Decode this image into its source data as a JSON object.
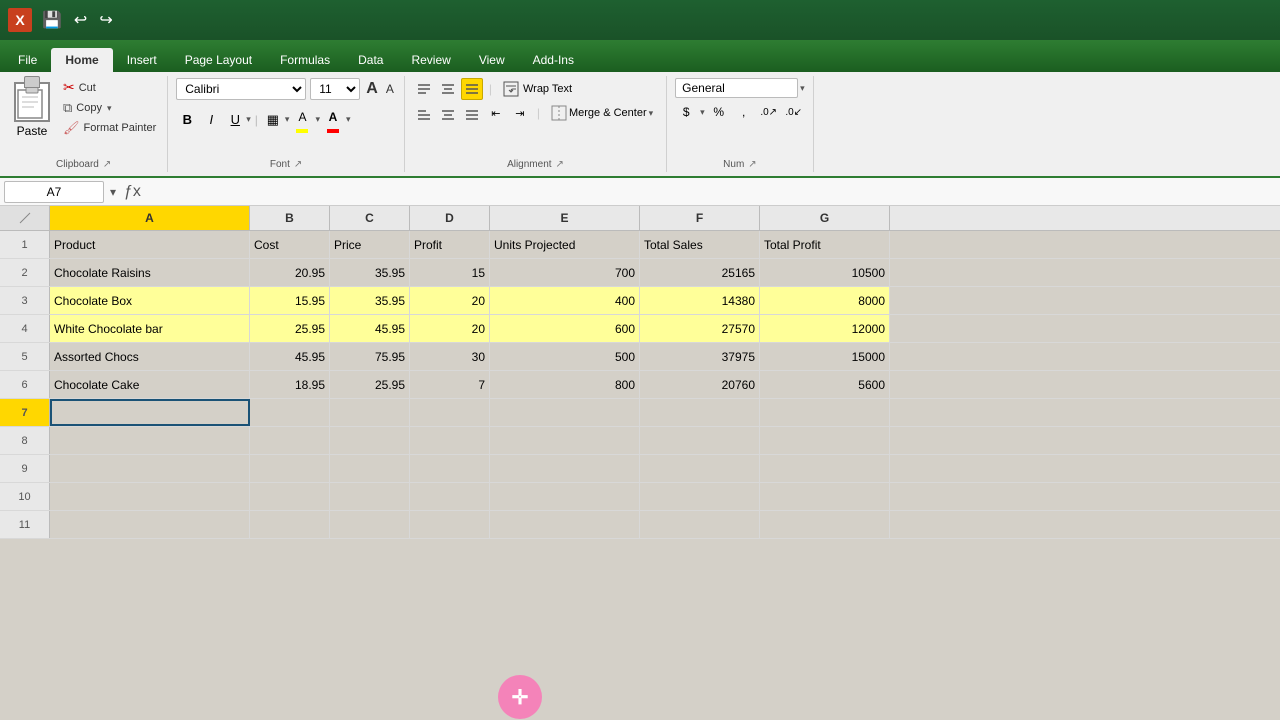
{
  "titlebar": {
    "app_icon": "X",
    "qs_save": "💾",
    "qs_undo": "↩",
    "qs_redo": "↪"
  },
  "ribbon_tabs": {
    "tabs": [
      "File",
      "Home",
      "Insert",
      "Page Layout",
      "Formulas",
      "Data",
      "Review",
      "View",
      "Add-Ins"
    ],
    "active": "Home"
  },
  "clipboard": {
    "paste_label": "Paste",
    "cut_label": "Cut",
    "copy_label": "Copy",
    "format_painter_label": "Format Painter",
    "group_title": "Clipboard"
  },
  "font": {
    "font_name": "Calibri",
    "font_size": "11",
    "grow_label": "A",
    "shrink_label": "A",
    "bold_label": "B",
    "italic_label": "I",
    "underline_label": "U",
    "border_label": "▦",
    "fill_label": "A",
    "color_label": "A",
    "group_title": "Font"
  },
  "alignment": {
    "top_left_label": "≡",
    "top_center_label": "≡",
    "top_right_label": "≡",
    "wrap_text_label": "Wrap Text",
    "merge_label": "Merge & Center",
    "bottom_left_label": "≡",
    "bottom_center_label": "≡",
    "bottom_right_label": "≡",
    "indent_decrease": "⇤",
    "indent_increase": "⇥",
    "group_title": "Alignment"
  },
  "number": {
    "format_label": "General",
    "group_title": "Num"
  },
  "formula_bar": {
    "cell_ref": "A7",
    "formula_content": ""
  },
  "columns": {
    "headers": [
      "A",
      "B",
      "C",
      "D",
      "E",
      "F",
      "G"
    ],
    "active": "A"
  },
  "rows": [
    {
      "num": 1,
      "style": "normal",
      "cells": [
        "Product",
        "Cost",
        "Price",
        "Profit",
        "Units Projected",
        "Total Sales",
        "Total Profit"
      ]
    },
    {
      "num": 2,
      "style": "normal",
      "cells": [
        "Chocolate Raisins",
        "20.95",
        "35.95",
        "15",
        "700",
        "25165",
        "10500"
      ]
    },
    {
      "num": 3,
      "style": "yellow",
      "cells": [
        "Chocolate Box",
        "15.95",
        "35.95",
        "20",
        "400",
        "14380",
        "8000"
      ]
    },
    {
      "num": 4,
      "style": "yellow",
      "cells": [
        "White Chocolate bar",
        "25.95",
        "45.95",
        "20",
        "600",
        "27570",
        "12000"
      ]
    },
    {
      "num": 5,
      "style": "normal",
      "cells": [
        "Assorted Chocs",
        "45.95",
        "75.95",
        "30",
        "500",
        "37975",
        "15000"
      ]
    },
    {
      "num": 6,
      "style": "normal",
      "cells": [
        "Chocolate Cake",
        "18.95",
        "25.95",
        "7",
        "800",
        "20760",
        "5600"
      ]
    },
    {
      "num": 7,
      "style": "active",
      "cells": [
        "",
        "",
        "",
        "",
        "",
        "",
        ""
      ]
    },
    {
      "num": 8,
      "style": "empty",
      "cells": [
        "",
        "",
        "",
        "",
        "",
        "",
        ""
      ]
    },
    {
      "num": 9,
      "style": "empty",
      "cells": [
        "",
        "",
        "",
        "",
        "",
        "",
        ""
      ]
    },
    {
      "num": 10,
      "style": "empty",
      "cells": [
        "",
        "",
        "",
        "",
        "",
        "",
        ""
      ]
    },
    {
      "num": 11,
      "style": "empty",
      "cells": [
        "",
        "",
        "",
        "",
        "",
        "",
        ""
      ]
    }
  ],
  "cursor": {
    "symbol": "✛"
  }
}
